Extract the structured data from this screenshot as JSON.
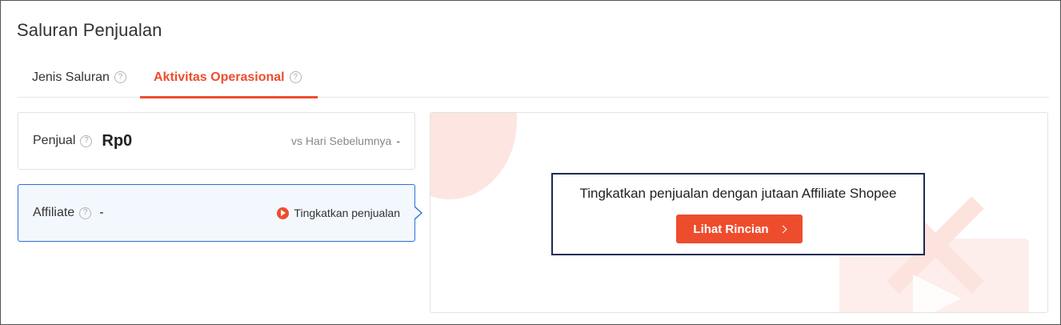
{
  "page": {
    "title": "Saluran Penjualan"
  },
  "tabs": [
    {
      "label": "Jenis Saluran",
      "active": false
    },
    {
      "label": "Aktivitas Operasional",
      "active": true
    }
  ],
  "help_glyph": "?",
  "cards": {
    "penjual": {
      "label": "Penjual",
      "value": "Rp0",
      "compare_label": "vs Hari Sebelumnya",
      "compare_value": "-"
    },
    "affiliate": {
      "label": "Affiliate",
      "value": "-",
      "action_label": "Tingkatkan penjualan"
    }
  },
  "promo": {
    "text": "Tingkatkan penjualan dengan jutaan Affiliate Shopee",
    "button_label": "Lihat Rincian"
  },
  "colors": {
    "accent": "#ee4d2d",
    "selected_border": "#2f6fd6",
    "promo_border": "#1a2c52"
  }
}
